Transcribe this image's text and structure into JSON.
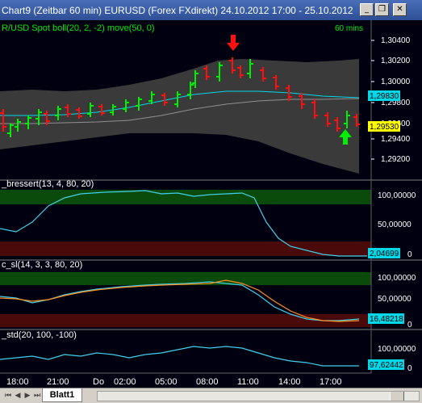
{
  "window": {
    "title": "Chart9  (Zeitbar 60 min)  EURUSD  (Forex FXdirekt)  24.10.2012 17:00 - 25.10.2012",
    "minimize_glyph": "_",
    "restore_glyph": "❐",
    "close_glyph": "✕"
  },
  "main_pane": {
    "label": "R/USD Spot  boll(20, 2, -2) move(50, 0)",
    "interval": "60 mins",
    "price_ticks": [
      "1,30400",
      "1,30200",
      "1,30000",
      "1,29800",
      "1,29600",
      "1,29400",
      "1,29200"
    ],
    "bollinger_label": "1,29830",
    "last_price_label": "1,29530",
    "colors": {
      "up_bar": "#00ee00",
      "down_bar": "#ff1010",
      "band_fill": "#3a3a3a",
      "mid_line": "#00d8e8",
      "move_line": "#808080",
      "bollinger_label_bg": "#00d8e8",
      "last_price_bg": "#ffff00"
    }
  },
  "pane_bressert": {
    "label": "_bressert(13, 4, 80, 20)",
    "ticks": [
      "100,00000",
      "50,00000",
      "0"
    ],
    "value_label": "2,04699",
    "line_color": "#40d0e8"
  },
  "pane_sl": {
    "label": "c_sl(14, 3, 3, 80, 20)",
    "ticks": [
      "100,00000",
      "50,00000",
      "0"
    ],
    "value_label": "16,48218",
    "line_colors": [
      "#40d0e8",
      "#ff9020"
    ]
  },
  "pane_std": {
    "label": "_std(20, 100, -100)",
    "ticks": [
      "100,00000",
      "0"
    ],
    "value_label": "97,62442",
    "line_color": "#40d0e8"
  },
  "time_axis": [
    "18:00",
    "21:00",
    "Do",
    "02:00",
    "05:00",
    "08:00",
    "11:00",
    "14:00",
    "17:00"
  ],
  "sheet": {
    "tab_label": "Blatt1"
  }
}
